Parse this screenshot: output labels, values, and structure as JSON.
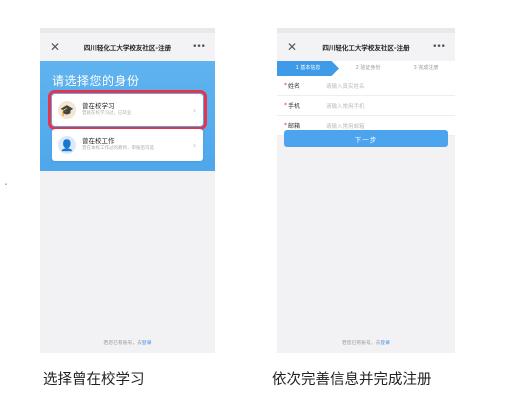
{
  "left_screen": {
    "title": "四川轻化工大学校友社区-注册",
    "heading": "请选择您的身份",
    "cards": [
      {
        "title": "曾在校学习",
        "subtitle": "曾就在校学习过，已毕业"
      },
      {
        "title": "曾在校工作",
        "subtitle": "曾在本校工作过的教师，审核后可选"
      }
    ],
    "footer": {
      "text": "若您已有账号，去",
      "link": "登录"
    }
  },
  "right_screen": {
    "title": "四川轻化工大学校友社区-注册",
    "steps": [
      "1 基本信息",
      "2 验证身份",
      "3 完成注册"
    ],
    "fields": [
      {
        "label": "姓名",
        "placeholder": "请输入真实姓名"
      },
      {
        "label": "手机",
        "placeholder": "请输入常用手机"
      },
      {
        "label": "邮箱",
        "placeholder": "请输入常用邮箱"
      }
    ],
    "next_label": "下一步",
    "footer": {
      "text": "若您已有账号，去",
      "link": "登录"
    }
  },
  "captions": {
    "left": "选择曾在校学习",
    "right": "依次完善信息并完成注册"
  },
  "icons": {
    "close": "close-icon",
    "more": "more-icon",
    "student_avatar": "graduate-avatar-icon",
    "staff_avatar": "teacher-avatar-icon",
    "chevron": "chevron-right-icon"
  },
  "colors": {
    "header_blue": "#4fa7ec",
    "button_blue": "#4ca3ee",
    "highlight_red": "#e8334a"
  }
}
